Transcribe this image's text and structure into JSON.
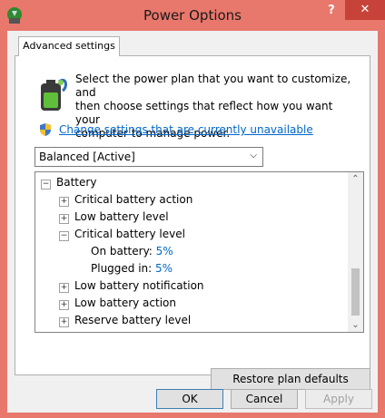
{
  "window": {
    "title": "Power Options",
    "help": "?",
    "close": "✕",
    "accent": "#e8776c"
  },
  "tab": {
    "label": "Advanced settings"
  },
  "description": "Select the power plan that you want to customize, and\nthen choose settings that reflect how you want your\ncomputer to manage power.",
  "change_link": "Change settings that are currently unavailable",
  "plan_select": {
    "value": "Balanced [Active]"
  },
  "tree": {
    "battery": "Battery",
    "critical_action": "Critical battery action",
    "low_level": "Low battery level",
    "critical_level": "Critical battery level",
    "on_battery_label": "On battery:",
    "on_battery_value": "5%",
    "plugged_in_label": "Plugged in:",
    "plugged_in_value": "5%",
    "low_notification": "Low battery notification",
    "low_action": "Low battery action",
    "reserve_level": "Reserve battery level"
  },
  "buttons": {
    "restore": "Restore plan defaults",
    "ok": "OK",
    "cancel": "Cancel",
    "apply": "Apply"
  }
}
